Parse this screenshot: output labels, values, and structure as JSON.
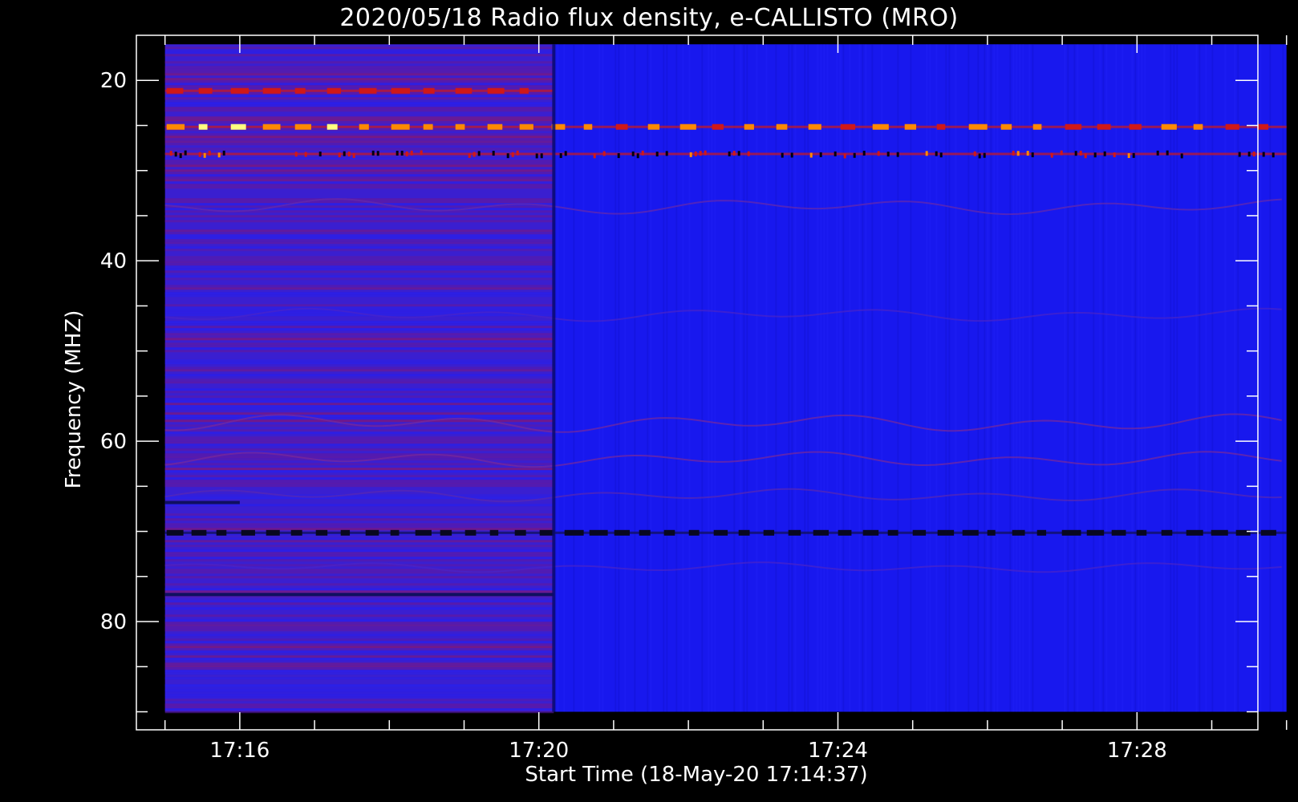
{
  "chart_data": {
    "type": "heatmap",
    "title": "2020/05/18  Radio flux density, e-CALLISTO (MRO)",
    "xlabel": "Start Time (18-May-20 17:14:37)",
    "ylabel": "Frequency (MHZ)",
    "x_unit": "time (HH:MM)",
    "y_unit": "MHz",
    "x_range": [
      "17:14:37",
      "17:29:37"
    ],
    "xlim_minutes": [
      14.617,
      29.617
    ],
    "ylim": [
      15,
      92
    ],
    "y_inverted": true,
    "x_ticks": [
      {
        "label": "17:16",
        "minute": 16
      },
      {
        "label": "17:20",
        "minute": 20
      },
      {
        "label": "17:24",
        "minute": 24
      },
      {
        "label": "17:28",
        "minute": 28
      }
    ],
    "x_minor_minutes": [
      15,
      16,
      17,
      18,
      19,
      20,
      21,
      22,
      23,
      24,
      25,
      26,
      27,
      28,
      29,
      30
    ],
    "y_ticks": [
      {
        "label": "20",
        "value": 20
      },
      {
        "label": "40",
        "value": 40
      },
      {
        "label": "60",
        "value": 60
      },
      {
        "label": "80",
        "value": 80
      }
    ],
    "y_minor": [
      20,
      25,
      30,
      35,
      40,
      45,
      50,
      55,
      60,
      65,
      70,
      75,
      80,
      85,
      90
    ],
    "data_extent": {
      "t_start_minute": 15.0,
      "t_end_minute": 30.0,
      "f_min": 16,
      "f_max": 90
    },
    "segment_change_minute": 20.2,
    "colors": {
      "background": "#000000",
      "segment1_base": "#3a1fd0",
      "segment1_alt": "#2020f0",
      "segment2_base": "#1818ee",
      "emission_red": "#d01818",
      "emission_orange": "#ff8a00",
      "emission_yellow": "#ffff80",
      "dark_band": "#101060"
    },
    "features": [
      {
        "kind": "rfi-band",
        "freq_mhz": 25.2,
        "t_from": 15.0,
        "t_to": 30.0,
        "intensity": "high",
        "dashed": true
      },
      {
        "kind": "rfi-band",
        "freq_mhz": 21.2,
        "t_from": 15.0,
        "t_to": 20.2,
        "intensity": "medium",
        "dashed": true
      },
      {
        "kind": "rfi-band",
        "freq_mhz": 28.2,
        "t_from": 15.0,
        "t_to": 30.0,
        "intensity": "medium",
        "dashed": false
      },
      {
        "kind": "rfi-band",
        "freq_mhz": 70.2,
        "t_from": 15.0,
        "t_to": 30.0,
        "intensity": "low",
        "dashed": true
      },
      {
        "kind": "dark-line",
        "freq_mhz": 77.0,
        "t_from": 15.0,
        "t_to": 20.2
      },
      {
        "kind": "dark-line",
        "freq_mhz": 66.8,
        "t_from": 15.0,
        "t_to": 16.0
      }
    ]
  }
}
